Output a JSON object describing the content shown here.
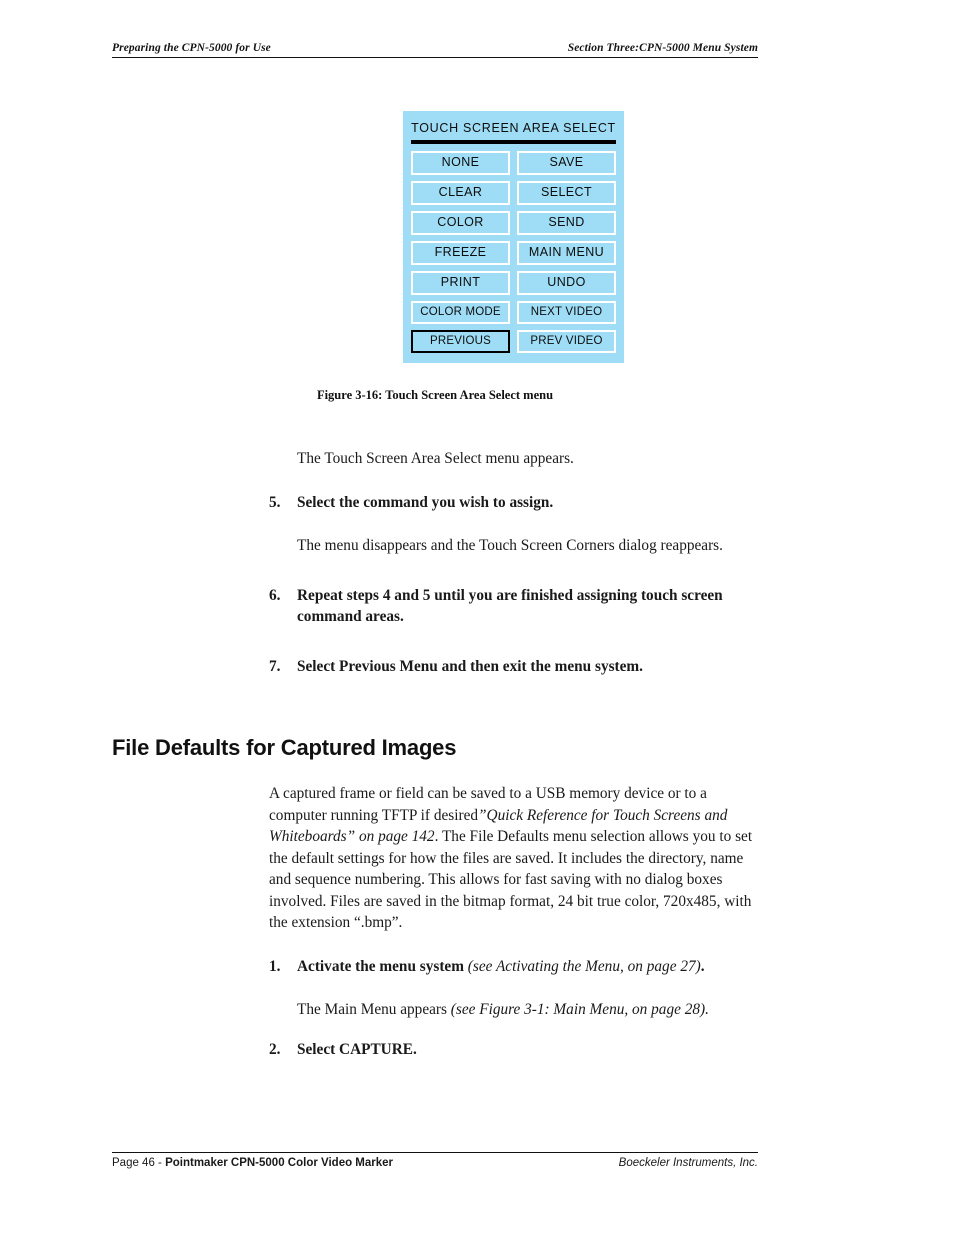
{
  "header": {
    "left": "Preparing the CPN-5000 for Use",
    "right": "Section Three:CPN-5000 Menu System"
  },
  "figure": {
    "menu_title": "TOUCH SCREEN AREA SELECT",
    "rows": [
      {
        "left": "NONE",
        "right": "SAVE"
      },
      {
        "left": "CLEAR",
        "right": "SELECT"
      },
      {
        "left": "COLOR",
        "right": "SEND"
      },
      {
        "left": "FREEZE",
        "right": "MAIN MENU"
      },
      {
        "left": "PRINT",
        "right": "UNDO"
      },
      {
        "left": "COLOR MODE",
        "right": "NEXT VIDEO"
      },
      {
        "left": "PREVIOUS",
        "right": "PREV VIDEO"
      }
    ],
    "highlighted_button": "PREVIOUS",
    "panel_color": "#9eddf5",
    "button_border_color": "#ffffff",
    "highlight_border_color": "#000000",
    "caption": "Figure 3-16:  Touch Screen Area Select menu"
  },
  "body": {
    "intro_line": "The Touch Screen Area Select menu appears.",
    "step5": {
      "num": "5.",
      "text": "Select the command you wish to assign."
    },
    "after_step5": "The menu disappears and the Touch Screen Corners dialog reappears.",
    "step6": {
      "num": "6.",
      "text": "Repeat steps 4 and 5 until you are finished assigning touch screen command areas."
    },
    "step7": {
      "num": "7.",
      "text": "Select Previous Menu and then exit the menu system."
    },
    "section_heading": "File Defaults for Captured Images",
    "paragraph": {
      "part1": "A captured frame or field can be saved to a USB memory device or to a computer running TFTP if desired",
      "cite": "”Quick Reference for Touch Screens and Whiteboards” on page 142",
      "part2": ". The File Defaults menu selection allows you to set the default settings for how the files are saved. It includes the directory, name and sequence numbering. This allows for fast saving with no dialog boxes involved. Files are saved in the bitmap format, 24 bit true color, 720x485, with the extension “.bmp”."
    },
    "step1": {
      "num": "1.",
      "text": "Activate the menu system",
      "note": " (see Activating the Menu, on page 27)",
      "tail": "."
    },
    "after_step1": {
      "text": "The Main Menu appears ",
      "note": "(see Figure 3-1: Main Menu, on page 28)."
    },
    "step2": {
      "num": "2.",
      "text": "Select CAPTURE."
    }
  },
  "footer": {
    "left_prefix": "Page 46 - ",
    "left_bold": "Pointmaker CPN-5000 Color Video Marker",
    "right": "Boeckeler Instruments, Inc."
  }
}
